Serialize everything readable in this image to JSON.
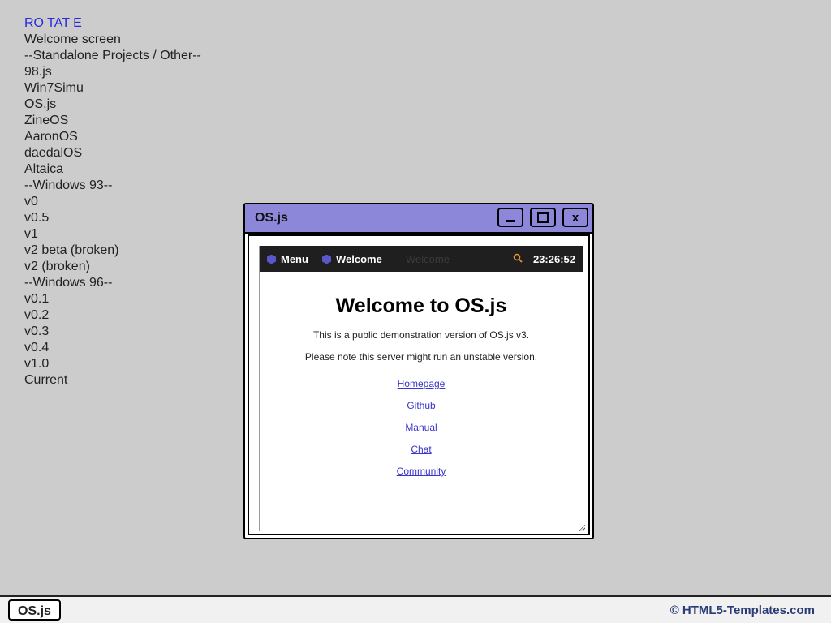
{
  "nav": {
    "items": [
      "RO TAT E",
      "Welcome screen",
      "--Standalone Projects / Other--",
      "98.js",
      "Win7Simu",
      "OS.js",
      "ZineOS",
      "AaronOS",
      "daedalOS",
      "Altaica",
      "--Windows 93--",
      "v0",
      "v0.5",
      "v1",
      "v2 beta (broken)",
      "v2 (broken)",
      "--Windows 96--",
      "v0.1",
      "v0.2",
      "v0.3",
      "v0.4",
      "v1.0",
      "Current"
    ]
  },
  "window": {
    "title": "OS.js",
    "minimize_label": "",
    "maximize_label": "",
    "close_label": "x",
    "accent": "#8c87d8"
  },
  "osjs_panel": {
    "menu_label": "Menu",
    "welcome_label": "Welcome",
    "ghost_label": "Welcome",
    "clock": "23:26:52"
  },
  "welcome": {
    "heading": "Welcome to OS.js",
    "line1": "This is a public demonstration version of OS.js v3.",
    "line2": "Please note this server might run an unstable version.",
    "links": [
      "Homepage",
      "Github",
      "Manual",
      "Chat",
      "Community"
    ]
  },
  "taskbar": {
    "task_label": "OS.js",
    "credit": "© HTML5-Templates.com"
  }
}
